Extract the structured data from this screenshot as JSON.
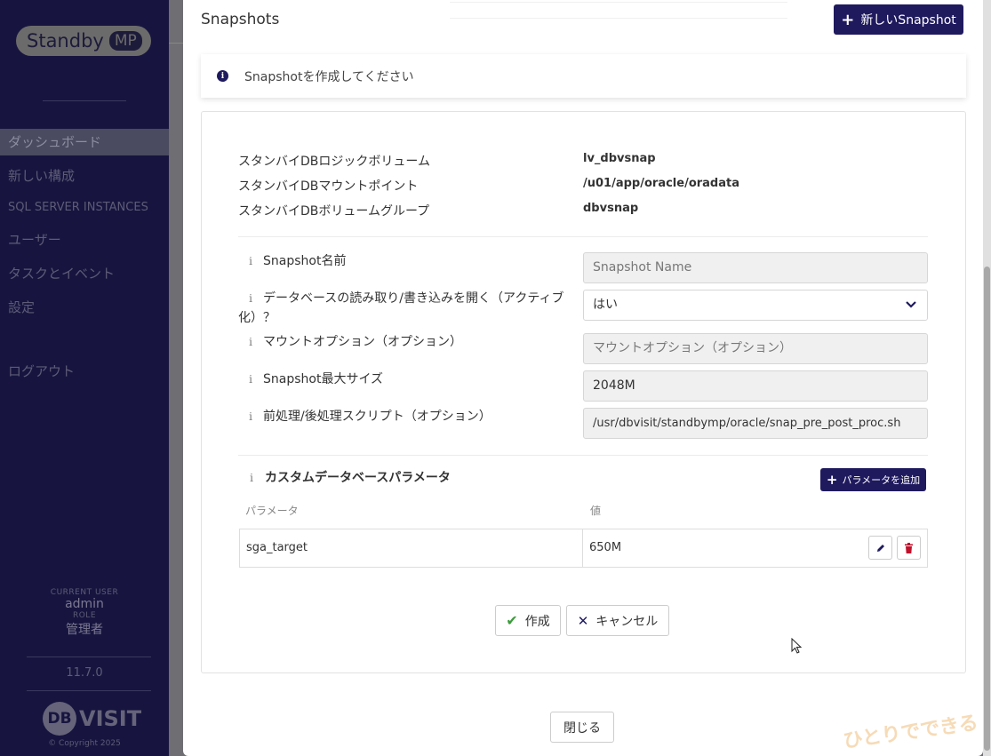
{
  "sidebar": {
    "logo_text": "Standby",
    "logo_badge": "MP",
    "items": [
      {
        "label": "ダッシュボード"
      },
      {
        "label": "新しい構成"
      },
      {
        "label": "SQL SERVER INSTANCES"
      },
      {
        "label": "ユーザー"
      },
      {
        "label": "タスクとイベント"
      },
      {
        "label": "設定"
      },
      {
        "label": "ログアウト"
      }
    ],
    "current_user_label": "CURRENT USER",
    "current_user": "admin",
    "role_label": "ROLE",
    "role": "管理者",
    "version": "11.7.0",
    "brand_db": "DB",
    "brand_rest": "VISIT",
    "copyright": "© Copyright 2025"
  },
  "modal": {
    "title": "Snapshots",
    "new_snapshot_label": "新しいSnapshot",
    "info_message": "Snapshotを作成してください",
    "readonly": [
      {
        "label": "スタンバイDBロジックボリューム",
        "value": "lv_dbvsnap"
      },
      {
        "label": "スタンバイDBマウントポイント",
        "value": "/u01/app/oracle/oradata"
      },
      {
        "label": "スタンバイDBボリュームグループ",
        "value": "dbvsnap"
      }
    ],
    "form": {
      "snapshot_name_label": "Snapshot名前",
      "snapshot_name_placeholder": "Snapshot Name",
      "open_rw_label": "データベースの読み取り/書き込みを開く（アクティブ化）？",
      "open_rw_value": "はい",
      "mount_options_label": "マウントオプション（オプション）",
      "mount_options_placeholder": "マウントオプション（オプション）",
      "max_size_label": "Snapshot最大サイズ",
      "max_size_value": "2048M",
      "script_label": "前処理/後処理スクリプト（オプション）",
      "script_value": "/usr/dbvisit/standbymp/oracle/snap_pre_post_proc.sh"
    },
    "custom_params": {
      "title": "カスタムデータベースパラメータ",
      "add_label": "パラメータを追加",
      "col_param": "パラメータ",
      "col_value": "値",
      "rows": [
        {
          "param": "sga_target",
          "value": "650M"
        }
      ]
    },
    "create_label": "作成",
    "cancel_label": "キャンセル",
    "close_label": "閉じる"
  },
  "watermark": "ひとりでできるもん",
  "colors": {
    "primary": "#1f1a5e",
    "sidebar_bg": "#17153f",
    "delete_red": "#c0102a",
    "success_green": "#3c9b3c"
  }
}
